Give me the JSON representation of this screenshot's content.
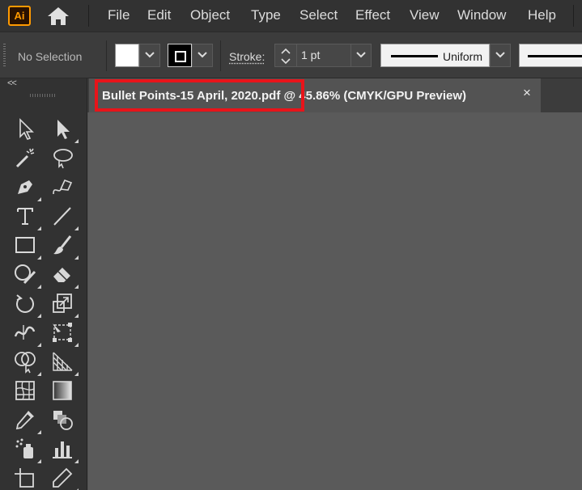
{
  "app": {
    "logo_text": "Ai",
    "accent": "#ff9a00"
  },
  "menu": [
    "File",
    "Edit",
    "Object",
    "Type",
    "Select",
    "Effect",
    "View",
    "Window",
    "Help"
  ],
  "control_bar": {
    "selection_status": "No Selection",
    "fill_color": "#ffffff",
    "stroke_color": "#000000",
    "stroke_label": "Stroke:",
    "stroke_weight": "1 pt",
    "profile_label": "Uniform"
  },
  "toolbar": {
    "collapse_label": "<<",
    "tools": [
      "selection-tool",
      "direct-selection-tool",
      "magic-wand-tool",
      "lasso-tool",
      "pen-tool",
      "curvature-tool",
      "type-tool",
      "line-segment-tool",
      "rectangle-tool",
      "paintbrush-tool",
      "shaper-tool",
      "eraser-tool",
      "rotate-tool",
      "scale-tool",
      "width-tool",
      "free-transform-tool",
      "shape-builder-tool",
      "perspective-grid-tool",
      "mesh-tool",
      "gradient-tool",
      "eyedropper-tool",
      "blend-tool",
      "symbol-sprayer-tool",
      "column-graph-tool",
      "artboard-tool",
      "slice-tool"
    ]
  },
  "document": {
    "tab_title": "Bullet Points-15 April, 2020.pdf @ 45.86% (CMYK/GPU Preview)",
    "close_glyph": "×",
    "highlight_color": "#e8141a"
  }
}
